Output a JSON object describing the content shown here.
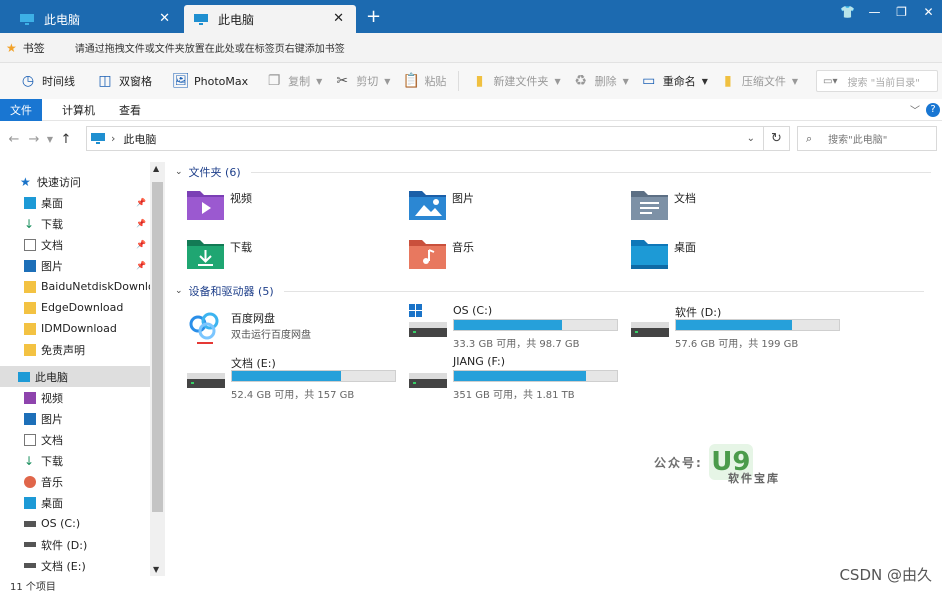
{
  "tabs": [
    {
      "title": "此电脑",
      "active": false
    },
    {
      "title": "此电脑",
      "active": true
    }
  ],
  "window_controls": [
    "shirt-icon",
    "minimize-icon",
    "restore-icon",
    "close-icon"
  ],
  "bookmark_bar": {
    "label": "书签",
    "hint": "请通过拖拽文件或文件夹放置在此处或在标签页右键添加书签"
  },
  "toolbar": {
    "timeline": "时间线",
    "dual_pane": "双窗格",
    "photomax": "PhotoMax",
    "copy": "复制",
    "cut": "剪切",
    "paste": "粘贴",
    "new_folder": "新建文件夹",
    "delete": "删除",
    "rename": "重命名",
    "compress": "压缩文件",
    "search_placeholder": "搜索 \"当前目录\""
  },
  "ribbon": {
    "file": "文件",
    "computer": "计算机",
    "view": "查看"
  },
  "address": {
    "segment": "此电脑",
    "search_placeholder": "搜索\"此电脑\""
  },
  "sidebar": {
    "quick_access": "快速访问",
    "quick_items": [
      {
        "label": "桌面",
        "pinned": true
      },
      {
        "label": "下载",
        "pinned": true
      },
      {
        "label": "文档",
        "pinned": true
      },
      {
        "label": "图片",
        "pinned": true
      },
      {
        "label": "BaiduNetdiskDownload",
        "pinned": false
      },
      {
        "label": "EdgeDownload",
        "pinned": false
      },
      {
        "label": "IDMDownload",
        "pinned": false
      },
      {
        "label": "免责声明",
        "pinned": false
      }
    ],
    "this_pc": "此电脑",
    "pc_items": [
      "视频",
      "图片",
      "文档",
      "下载",
      "音乐",
      "桌面",
      "OS (C:)",
      "软件 (D:)",
      "文档 (E:)"
    ]
  },
  "status": "11 个项目",
  "folders_group": {
    "title": "文件夹 (6)",
    "items": [
      "视频",
      "图片",
      "文档",
      "下载",
      "音乐",
      "桌面"
    ]
  },
  "drives_group": {
    "title": "设备和驱动器 (5)",
    "baidu": {
      "name": "百度网盘",
      "desc": "双击运行百度网盘"
    },
    "drives": [
      {
        "name": "OS (C:)",
        "info": "33.3 GB 可用，共 98.7 GB",
        "used_fraction": 0.66
      },
      {
        "name": "软件 (D:)",
        "info": "57.6 GB 可用，共 199 GB",
        "used_fraction": 0.71
      },
      {
        "name": "文档 (E:)",
        "info": "52.4 GB 可用，共 157 GB",
        "used_fraction": 0.67
      },
      {
        "name": "JIANG (F:)",
        "info": "351 GB 可用，共 1.81 TB",
        "used_fraction": 0.81
      }
    ]
  },
  "watermark": {
    "label": "公众号:",
    "logo": "U9",
    "sub": "软件宝库"
  },
  "csdn": "CSDN @由久"
}
